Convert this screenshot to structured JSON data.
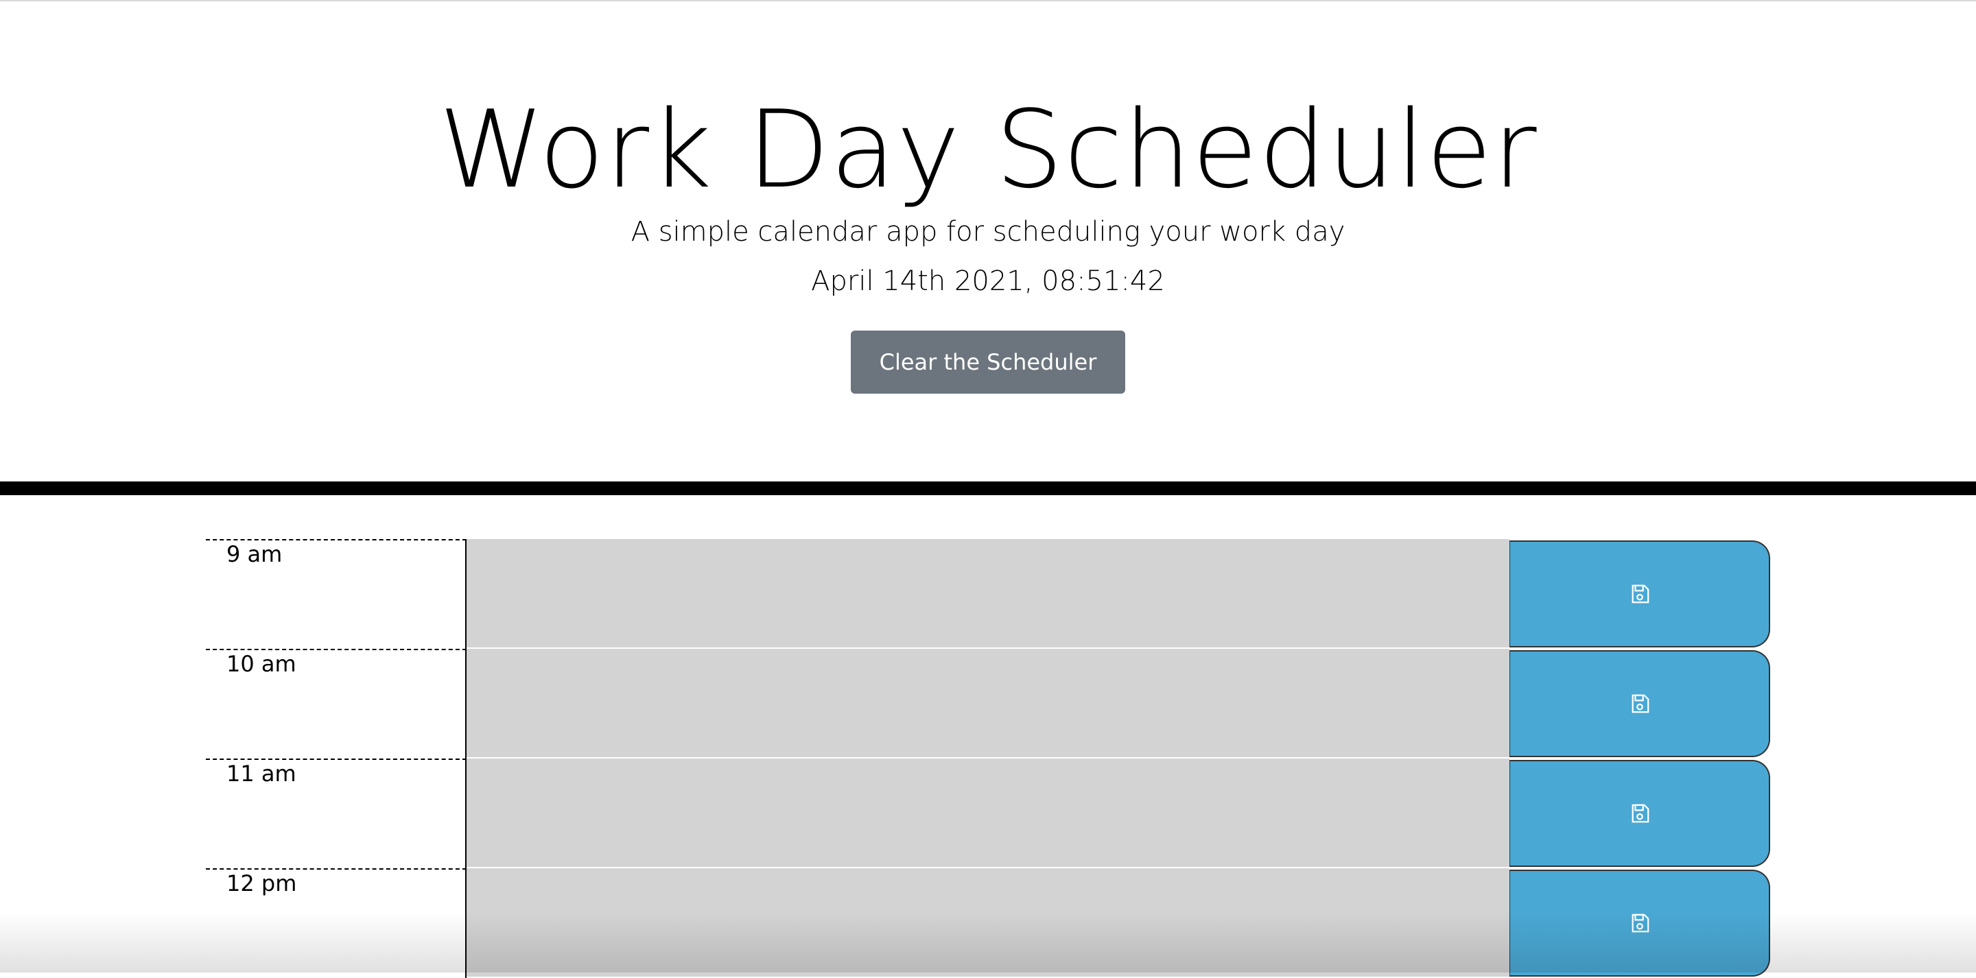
{
  "header": {
    "title": "Work Day Scheduler",
    "subtitle": "A simple calendar app for scheduling your work day",
    "current_datetime": "April 14th 2021, 08:51:42",
    "clear_button_label": "Clear the Scheduler"
  },
  "colors": {
    "clear_button_bg": "#6c757d",
    "save_button_bg": "#4aa8d4",
    "description_bg": "#d3d3d3",
    "divider": "#000000"
  },
  "time_blocks": [
    {
      "hour": "9 am",
      "description": "",
      "save_icon": "save-icon"
    },
    {
      "hour": "10 am",
      "description": "",
      "save_icon": "save-icon"
    },
    {
      "hour": "11 am",
      "description": "",
      "save_icon": "save-icon"
    },
    {
      "hour": "12 pm",
      "description": "",
      "save_icon": "save-icon"
    }
  ]
}
